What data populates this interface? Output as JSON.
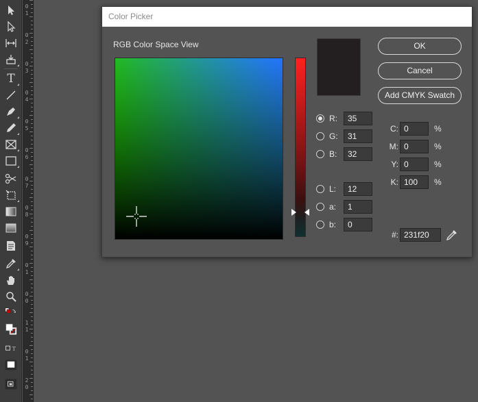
{
  "toolbar": {
    "tools": [
      "selection-tool-icon",
      "direct-selection-tool-icon",
      "gap-tool-icon",
      "content-collector-tool-icon",
      "type-tool-icon",
      "line-tool-icon",
      "pen-tool-icon",
      "pencil-tool-icon",
      "rectangle-frame-tool-icon",
      "rectangle-tool-icon",
      "scissors-tool-icon",
      "free-transform-tool-icon",
      "gradient-swatch-tool-icon",
      "gradient-feather-tool-icon",
      "note-tool-icon",
      "eyedropper-tool-icon",
      "hand-tool-icon",
      "zoom-tool-icon"
    ],
    "type_glyph": "T",
    "fill_color": "#ffffff",
    "stroke_color": "#ffffff"
  },
  "ruler": {
    "labels": [
      "0",
      "1",
      "0",
      "2",
      "0",
      "3",
      "0",
      "4",
      "0",
      "5",
      "0",
      "6",
      "0",
      "7",
      "0",
      "8",
      "0",
      "9",
      "0",
      "1",
      "0",
      "0",
      "1",
      "1",
      "0",
      "1",
      "2",
      "0"
    ]
  },
  "dialog": {
    "title": "Color Picker",
    "space_label": "RGB Color Space View",
    "swatch_color": "#231f20",
    "buttons": {
      "ok": "OK",
      "cancel": "Cancel",
      "add_swatch": "Add CMYK Swatch"
    },
    "rgb": {
      "r_label": "R:",
      "r_value": "35",
      "g_label": "G:",
      "g_value": "31",
      "b_label": "B:",
      "b_value": "32"
    },
    "lab": {
      "l_label": "L:",
      "l_value": "12",
      "a_label": "a:",
      "a_value": "1",
      "b_label": "b:",
      "b_value": "0"
    },
    "cmyk": {
      "c_label": "C:",
      "c_value": "0",
      "m_label": "M:",
      "m_value": "0",
      "y_label": "Y:",
      "y_value": "0",
      "k_label": "K:",
      "k_value": "100",
      "unit": "%"
    },
    "hex": {
      "label": "#:",
      "value": "231f20"
    }
  }
}
